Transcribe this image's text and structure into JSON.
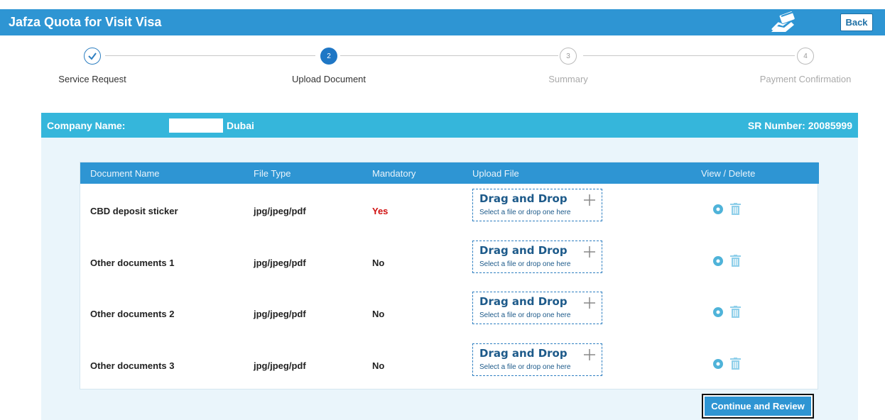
{
  "header": {
    "title": "Jafza Quota for Visit Visa",
    "back_label": "Back",
    "brand_icon": "hand-card-icon"
  },
  "stepper": {
    "steps": [
      {
        "number": "1",
        "label": "Service Request",
        "state": "done"
      },
      {
        "number": "2",
        "label": "Upload Document",
        "state": "active"
      },
      {
        "number": "3",
        "label": "Summary",
        "state": "pending"
      },
      {
        "number": "4",
        "label": "Payment Confirmation",
        "state": "pending"
      }
    ]
  },
  "company_bar": {
    "company_label": "Company Name:",
    "company_value": "Dubai",
    "sr_label": "SR Number: 20085999"
  },
  "table": {
    "headers": [
      "Document Name",
      "File Type",
      "Mandatory",
      "Upload File",
      "View / Delete"
    ],
    "rows": [
      {
        "name": "CBD deposit sticker",
        "file_type": "jpg/jpeg/pdf",
        "mandatory": "Yes"
      },
      {
        "name": "Other documents 1",
        "file_type": "jpg/jpeg/pdf",
        "mandatory": "No"
      },
      {
        "name": "Other documents 2",
        "file_type": "jpg/jpeg/pdf",
        "mandatory": "No"
      },
      {
        "name": "Other documents 3",
        "file_type": "jpg/jpeg/pdf",
        "mandatory": "No"
      }
    ],
    "dropzone": {
      "title": "Drag and Drop",
      "subtitle": "Select a file or drop one here"
    }
  },
  "actions": {
    "continue_label": "Continue and Review"
  },
  "colors": {
    "primary": "#2e95d3",
    "company_bar": "#35b6db",
    "panel_bg": "#eaf5fb",
    "mandatory_yes": "#d01010",
    "icon_teal": "#4fb3d9"
  }
}
